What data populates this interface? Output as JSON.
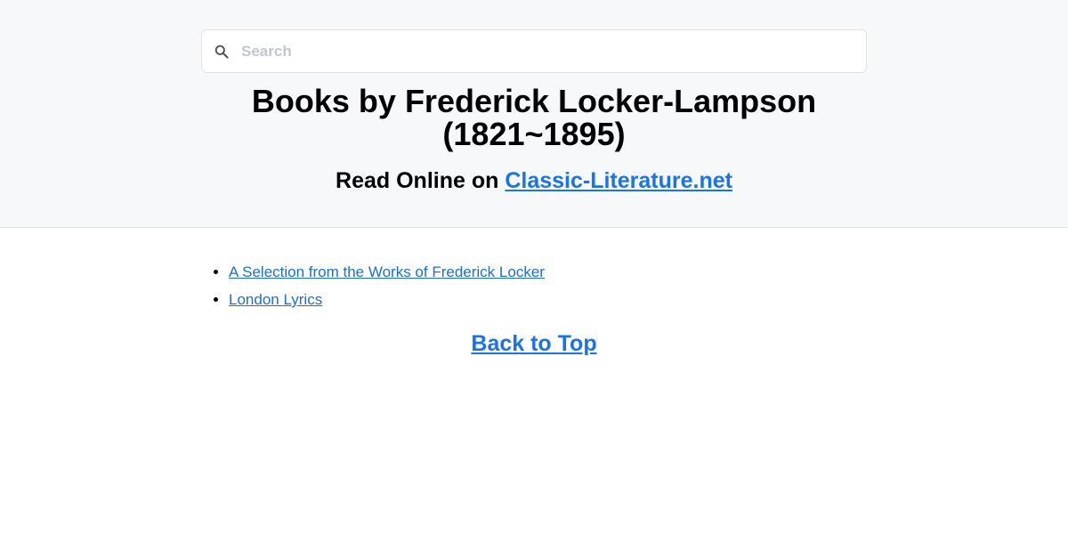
{
  "search": {
    "placeholder": "Search",
    "icon": "search-icon"
  },
  "header": {
    "title_line1": "Books by Frederick Locker-Lampson",
    "title_line2": "(1821~1895)",
    "subtitle_prefix": "Read Online on ",
    "site_link": "Classic-Literature.net"
  },
  "books": [
    {
      "title": "A Selection from the Works of Frederick Locker"
    },
    {
      "title": "London Lyrics"
    }
  ],
  "footer": {
    "back_to_top": "Back to Top"
  },
  "colors": {
    "link": "#1a73e8",
    "header_bg": "#f7f8fa"
  }
}
